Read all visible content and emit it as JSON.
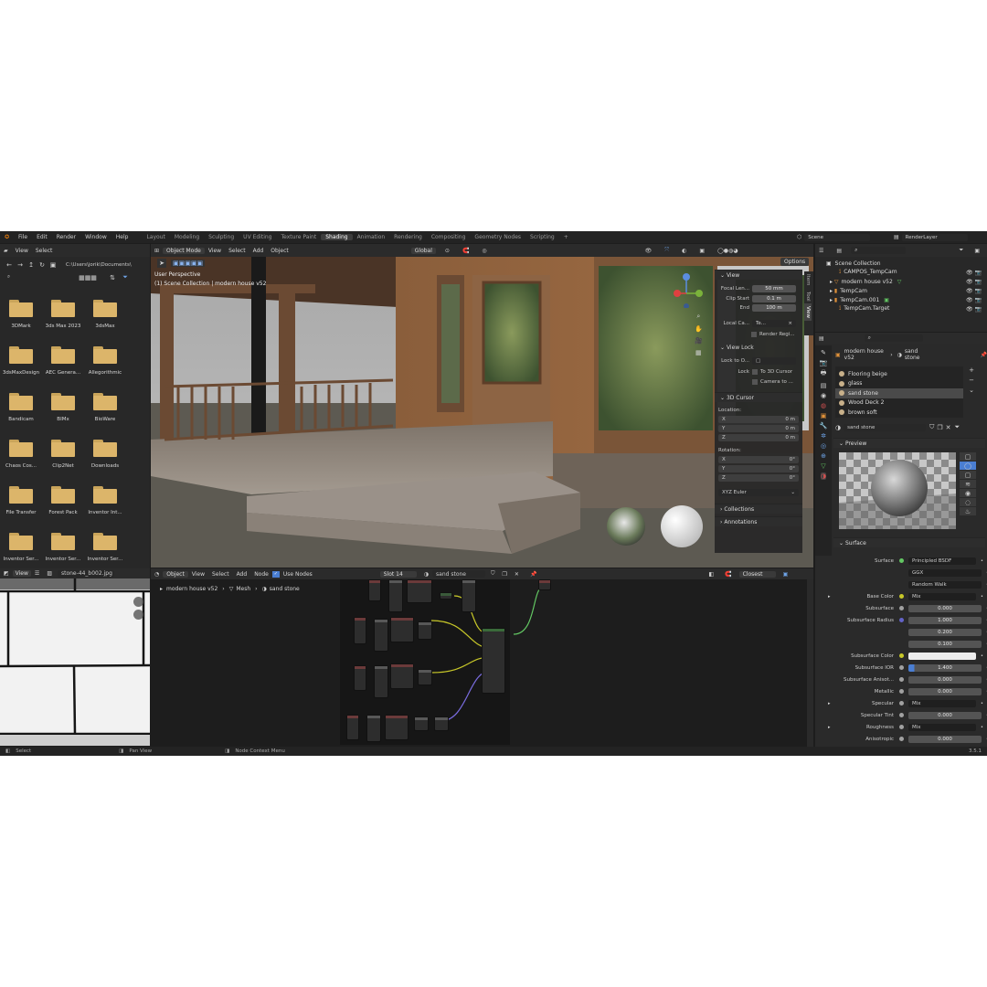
{
  "menu": {
    "items": [
      "File",
      "Edit",
      "Render",
      "Window",
      "Help"
    ]
  },
  "workspaces": [
    "Layout",
    "Modeling",
    "Sculpting",
    "UV Editing",
    "Texture Paint",
    "Shading",
    "Animation",
    "Rendering",
    "Compositing",
    "Geometry Nodes",
    "Scripting",
    "+"
  ],
  "scene": {
    "label": "Scene",
    "layer": "RenderLayer"
  },
  "filebrowser": {
    "view": "View",
    "select": "Select",
    "path": "C:\\Users\\jorik\\Documents\\",
    "folders": [
      "3DMark",
      "3ds Max 2023",
      "3dsMax",
      "3dsMaxDesign",
      "AEC Genera...",
      "Allegorithmic",
      "Bandicam",
      "BIMx",
      "BioWare",
      "Chaos Cos...",
      "Clip2Net",
      "Downloads",
      "File Transfer",
      "Forest Pack",
      "Inventor Int...",
      "Inventor Ser...",
      "Inventor Ser...",
      "Inventor Ser..."
    ]
  },
  "viewport": {
    "mode": "Object Mode",
    "menus": [
      "View",
      "Select",
      "Add",
      "Object"
    ],
    "transform": "Global",
    "options": "Options",
    "persp": "User Perspective",
    "collection": "(1) Scene Collection | modern house v52",
    "tabs": [
      "Item",
      "Tool",
      "View"
    ]
  },
  "npanel": {
    "view_title": "View",
    "focal_label": "Focal Len...",
    "focal_val": "50 mm",
    "clip_start_label": "Clip Start",
    "clip_start_val": "0.1 m",
    "end_label": "End",
    "end_val": "100 m",
    "local_cam": "Local Ca...",
    "local_cam_val": "Te...",
    "render_region": "Render Regi...",
    "viewlock_title": "View Lock",
    "lock_to": "Lock to O...",
    "lock": "Lock",
    "to_cursor": "To 3D Cursor",
    "cam_to": "Camera to ...",
    "cursor_title": "3D Cursor",
    "location": "Location:",
    "rotation": "Rotation:",
    "axes": [
      "X",
      "Y",
      "Z"
    ],
    "loc_vals": [
      "0 m",
      "0 m",
      "0 m"
    ],
    "rot_vals": [
      "0°",
      "0°",
      "0°"
    ],
    "euler": "XYZ Euler",
    "collections": "Collections",
    "annotations": "Annotations"
  },
  "imageeditor": {
    "view": "View",
    "image": "stone-44_b002.jpg"
  },
  "nodeeditor": {
    "object": "Object",
    "menus": [
      "View",
      "Select",
      "Add",
      "Node"
    ],
    "use_nodes": "Use Nodes",
    "slot": "Slot 14",
    "material": "sand stone",
    "breadcrumb": [
      "modern house v52",
      "Mesh",
      "sand stone"
    ],
    "closest": "Closest"
  },
  "statusbar": {
    "select": "Select",
    "pan": "Pan View",
    "context": "Node Context Menu",
    "version": "3.5.1"
  },
  "outliner": {
    "title": "Scene Collection",
    "items": [
      "CAMPOS_TempCam",
      "modern house v52",
      "TempCam",
      "TempCam.001",
      "TempCam.Target"
    ]
  },
  "properties": {
    "object": "modern house v52",
    "material": "sand stone",
    "slots": [
      "Flooring beige",
      "glass",
      "sand stone",
      "Wood Deck 2",
      "brown soft"
    ],
    "mat_field": "sand stone",
    "preview": "Preview",
    "surface": "Surface",
    "rows": [
      {
        "label": "Surface",
        "value": "Principled BSDF",
        "kind": "link"
      },
      {
        "label": "",
        "value": "GGX",
        "kind": "drop"
      },
      {
        "label": "",
        "value": "Random Walk",
        "kind": "drop"
      },
      {
        "label": "Base Color",
        "value": "Mix",
        "kind": "link"
      },
      {
        "label": "Subsurface",
        "value": "0.000",
        "kind": "num"
      },
      {
        "label": "Subsurface Radius",
        "value": "1.000",
        "kind": "num"
      },
      {
        "label": "",
        "value": "0.200",
        "kind": "num"
      },
      {
        "label": "",
        "value": "0.100",
        "kind": "num"
      },
      {
        "label": "Subsurface Color",
        "value": "",
        "kind": "color"
      },
      {
        "label": "Subsurface IOR",
        "value": "1.400",
        "kind": "num"
      },
      {
        "label": "Subsurface Anisot...",
        "value": "0.000",
        "kind": "num"
      },
      {
        "label": "Metallic",
        "value": "0.000",
        "kind": "num"
      },
      {
        "label": "Specular",
        "value": "Mix",
        "kind": "link"
      },
      {
        "label": "Specular Tint",
        "value": "0.000",
        "kind": "num"
      },
      {
        "label": "Roughness",
        "value": "Mix",
        "kind": "link"
      },
      {
        "label": "Anisotropic",
        "value": "0.000",
        "kind": "num"
      }
    ]
  }
}
